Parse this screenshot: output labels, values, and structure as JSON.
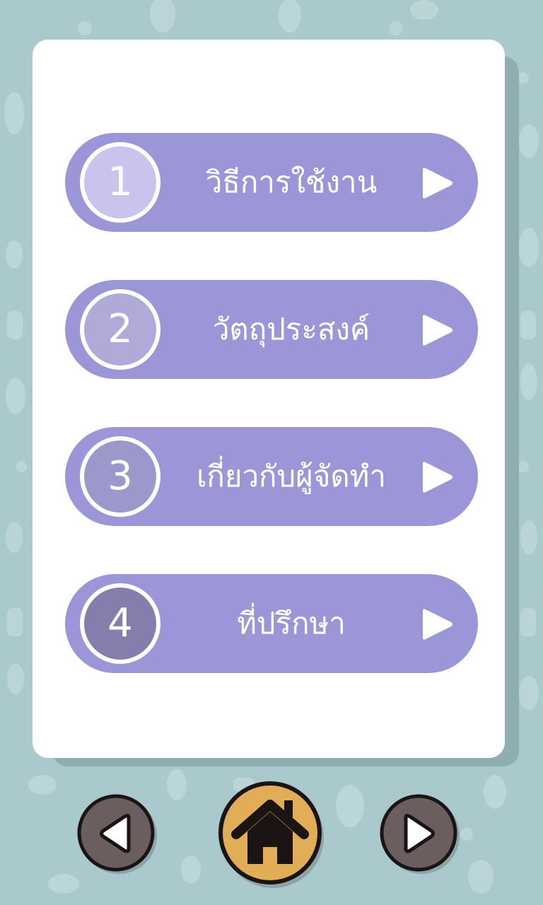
{
  "colors": {
    "background": "#a9c9cc",
    "card": "#ffffff",
    "button": "#9b96d8",
    "circle_1": "#c8c4ee",
    "circle_2": "#b0aad8",
    "circle_3": "#9d98cc",
    "circle_4": "#857ead",
    "nav_dark": "#6a5f5e",
    "home_gold": "#e2ad57"
  },
  "menu": {
    "items": [
      {
        "number": "1",
        "label": "วิธีการใช้งาน",
        "icon": "play-arrow-icon"
      },
      {
        "number": "2",
        "label": "วัตถุประสงค์",
        "icon": "play-arrow-icon"
      },
      {
        "number": "3",
        "label": "เกี่ยวกับผู้จัดทำ",
        "icon": "play-arrow-icon"
      },
      {
        "number": "4",
        "label": "ที่ปรึกษา",
        "icon": "play-arrow-icon"
      }
    ]
  },
  "nav": {
    "prev_icon": "back-arrow-icon",
    "home_icon": "home-icon",
    "next_icon": "forward-arrow-icon"
  }
}
